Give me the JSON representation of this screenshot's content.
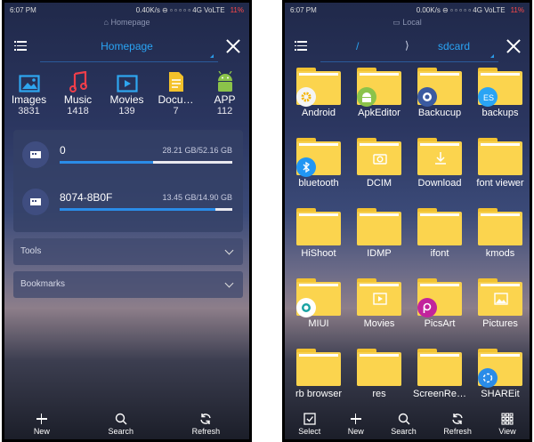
{
  "left": {
    "status": {
      "time": "6:07 PM",
      "network": "0.40K/s ⊖ ▫ ▫ ▫ ▫ ▫ 4G VoLTE",
      "battery": "11%"
    },
    "header_hint": "⌂ Homepage",
    "title": "Homepage",
    "categories": [
      {
        "label": "Images",
        "count": "3831",
        "icon": "image-icon",
        "color": "#2ea6f0"
      },
      {
        "label": "Music",
        "count": "1418",
        "icon": "music-icon",
        "color": "#ef3e4a"
      },
      {
        "label": "Movies",
        "count": "139",
        "icon": "movie-icon",
        "color": "#2ea6f0"
      },
      {
        "label": "Docu…",
        "count": "7",
        "icon": "document-icon",
        "color": "#f4c22b"
      },
      {
        "label": "APP",
        "count": "112",
        "icon": "android-icon",
        "color": "#8bc34a"
      }
    ],
    "storages": [
      {
        "name": "0",
        "size": "28.21 GB/52.16 GB",
        "used_fraction": 0.54
      },
      {
        "name": "8074-8B0F",
        "size": "13.45 GB/14.90 GB",
        "used_fraction": 0.9
      }
    ],
    "sections": [
      "Tools",
      "Bookmarks"
    ],
    "bottom": [
      "New",
      "Search",
      "Refresh"
    ]
  },
  "right": {
    "status": {
      "time": "6:07 PM",
      "network": "0.00K/s ⊖ ▫ ▫ ▫ ▫ ▫ 4G VoLTE",
      "battery": "11%"
    },
    "header_hint": "▭ Local",
    "path": {
      "root": "/",
      "sep": "⟩",
      "current": "sdcard"
    },
    "folders": [
      {
        "name": "Android",
        "badge": "gear"
      },
      {
        "name": "ApkEditor",
        "badge": "android"
      },
      {
        "name": "Backucup",
        "badge": "photo"
      },
      {
        "name": "backups",
        "badge": "es"
      },
      {
        "name": "bluetooth",
        "badge": "bluetooth"
      },
      {
        "name": "DCIM",
        "badge": "camera"
      },
      {
        "name": "Download",
        "badge": "download"
      },
      {
        "name": "font viewer",
        "badge": ""
      },
      {
        "name": "HiShoot",
        "badge": ""
      },
      {
        "name": "IDMP",
        "badge": ""
      },
      {
        "name": "ifont",
        "badge": ""
      },
      {
        "name": "kmods",
        "badge": ""
      },
      {
        "name": "MIUI",
        "badge": "miui"
      },
      {
        "name": "Movies",
        "badge": "play"
      },
      {
        "name": "PicsArt",
        "badge": "picsart"
      },
      {
        "name": "Pictures",
        "badge": "picture"
      },
      {
        "name": "rb browser",
        "badge": ""
      },
      {
        "name": "res",
        "badge": ""
      },
      {
        "name": "ScreenRe…",
        "badge": ""
      },
      {
        "name": "SHAREit",
        "badge": "shareit"
      }
    ],
    "bottom": [
      "Select",
      "New",
      "Search",
      "Refresh",
      "View"
    ]
  }
}
